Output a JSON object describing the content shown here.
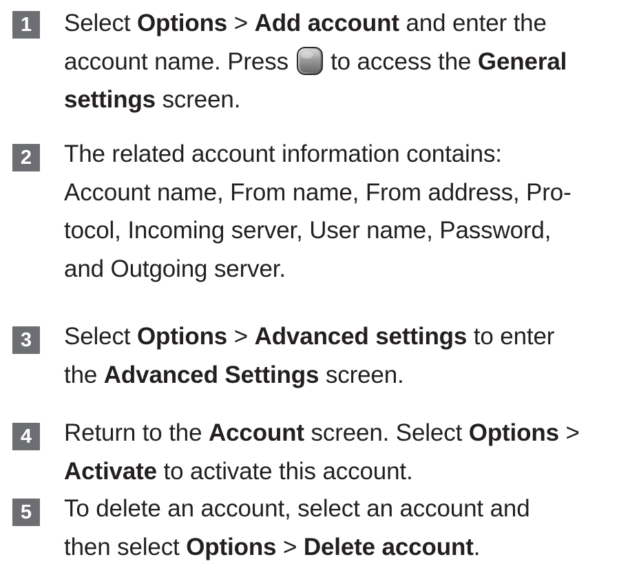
{
  "steps": [
    {
      "number": "1",
      "lines": [
        [
          "Select ",
          "Options",
          " > ",
          "Add account",
          " and enter the"
        ],
        [
          "account name. Press ",
          "[key]",
          " to access the ",
          "General"
        ],
        [
          "settings",
          " screen."
        ]
      ],
      "icon": "menu-key-icon"
    },
    {
      "number": "2",
      "lines": [
        [
          "The related account information contains:"
        ],
        [
          "Account name, From name, From address, Pro-"
        ],
        [
          "tocol, Incoming server, User name, Password,"
        ],
        [
          "and Outgoing server."
        ]
      ]
    },
    {
      "number": "3",
      "lines": [
        [
          "Select ",
          "Options",
          " > ",
          "Advanced settings",
          " to enter"
        ],
        [
          "the ",
          "Advanced Settings",
          " screen."
        ]
      ]
    },
    {
      "number": "4",
      "lines": [
        [
          "Return to the ",
          "Account",
          " screen. Select ",
          "Options",
          " >"
        ],
        [
          "Activate",
          " to activate this account."
        ]
      ]
    },
    {
      "number": "5",
      "lines": [
        [
          "To delete an account, select an account and"
        ],
        [
          "then select ",
          "Options",
          " > ",
          "Delete account",
          "."
        ]
      ]
    }
  ],
  "colors": {
    "badge_bg": "#6d6e71",
    "badge_text": "#ffffff",
    "body_text": "#231f20"
  }
}
